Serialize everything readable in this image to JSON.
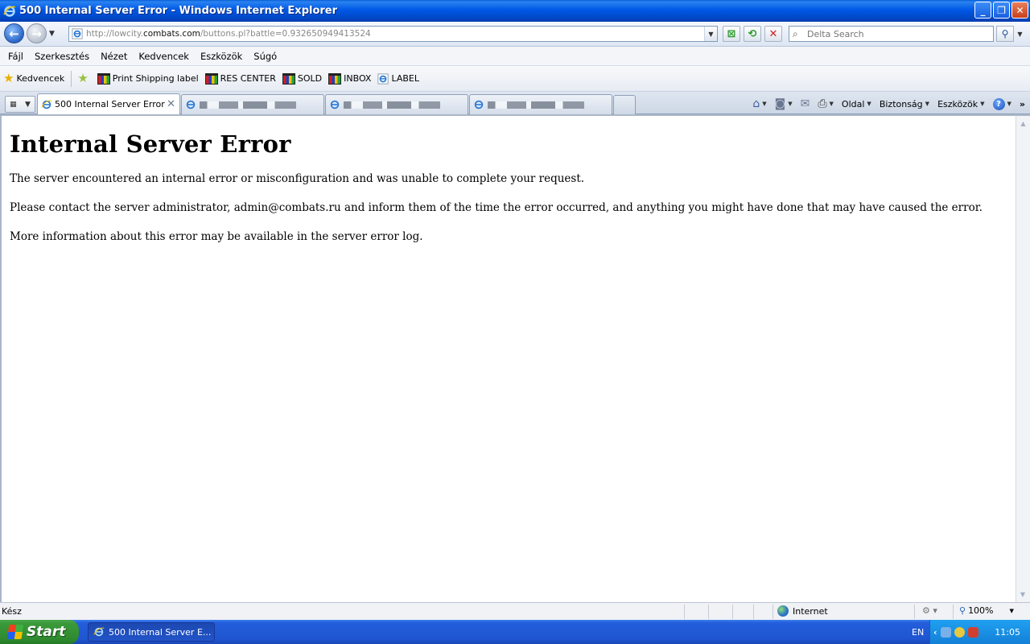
{
  "window": {
    "title": "500 Internal Server Error - Windows Internet Explorer",
    "buttons": {
      "minimize": "_",
      "maximize": "❐",
      "close": "✕"
    }
  },
  "address_bar": {
    "url_prefix": "http://lowcity.",
    "url_domain": "combats.com",
    "url_rest": "/buttons.pl?battle=0.932650949413524"
  },
  "search": {
    "placeholder": "Delta Search"
  },
  "menu": {
    "items": [
      "Fájl",
      "Szerkesztés",
      "Nézet",
      "Kedvencek",
      "Eszközök",
      "Súgó"
    ]
  },
  "favorites": {
    "label": "Kedvencek",
    "items": [
      "Print Shipping label",
      "RES CENTER",
      "SOLD",
      "INBOX",
      "LABEL"
    ]
  },
  "tabs": {
    "active": "500 Internal Server Error"
  },
  "command_bar": {
    "page": "Oldal",
    "safety": "Biztonság",
    "tools": "Eszközök"
  },
  "page": {
    "heading": "Internal Server Error",
    "paragraphs": [
      "The server encountered an internal error or misconfiguration and was unable to complete your request.",
      "Please contact the server administrator, admin@combats.ru and inform them of the time the error occurred, and anything you might have done that may have caused the error.",
      "More information about this error may be available in the server error log."
    ]
  },
  "status_bar": {
    "status": "Kész",
    "zone": "Internet",
    "zoom": "100%"
  },
  "taskbar": {
    "start": "Start",
    "task": "500 Internal Server E...",
    "language": "EN",
    "clock": "11:05"
  },
  "colors": {
    "title_bar": "#0058e6",
    "taskbar": "#245edb",
    "start_button": "#3a9a3a"
  }
}
